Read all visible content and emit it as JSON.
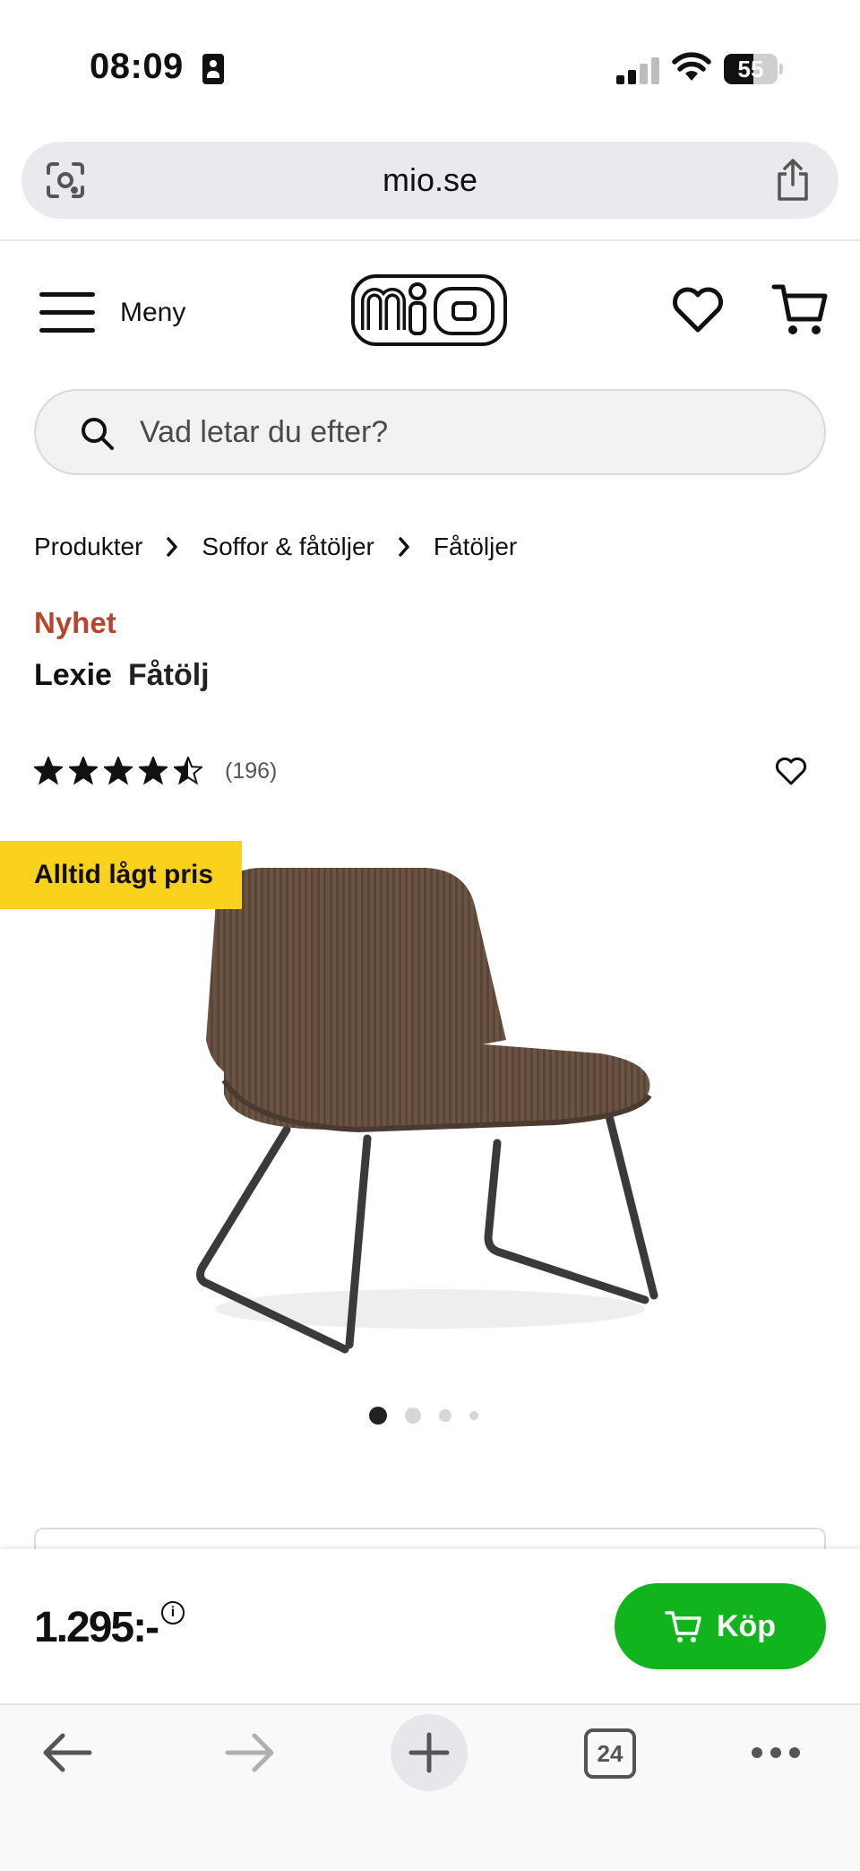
{
  "status_bar": {
    "time": "08:09",
    "battery": "55",
    "battery_level": 0.55
  },
  "browser": {
    "url": "mio.se",
    "tab_count": "24"
  },
  "header": {
    "menu_label": "Meny",
    "logo_text": "mio"
  },
  "search": {
    "placeholder": "Vad letar du efter?"
  },
  "breadcrumb": [
    "Produkter",
    "Soffor & fåtöljer",
    "Fåtöljer"
  ],
  "product": {
    "badge": "Nyhet",
    "name": "Lexie",
    "type": "Fåtölj",
    "rating": 4.5,
    "review_count": "(196)",
    "promo_badge": "Alltid lågt pris",
    "gallery_dots": 4,
    "gallery_active": 0
  },
  "buy_bar": {
    "price": "1.295:-",
    "price_info": "i",
    "buy_label": "Köp",
    "accent": "#12b41d"
  },
  "colors": {
    "badge_new": "#b5452c",
    "promo": "#fad11d"
  }
}
